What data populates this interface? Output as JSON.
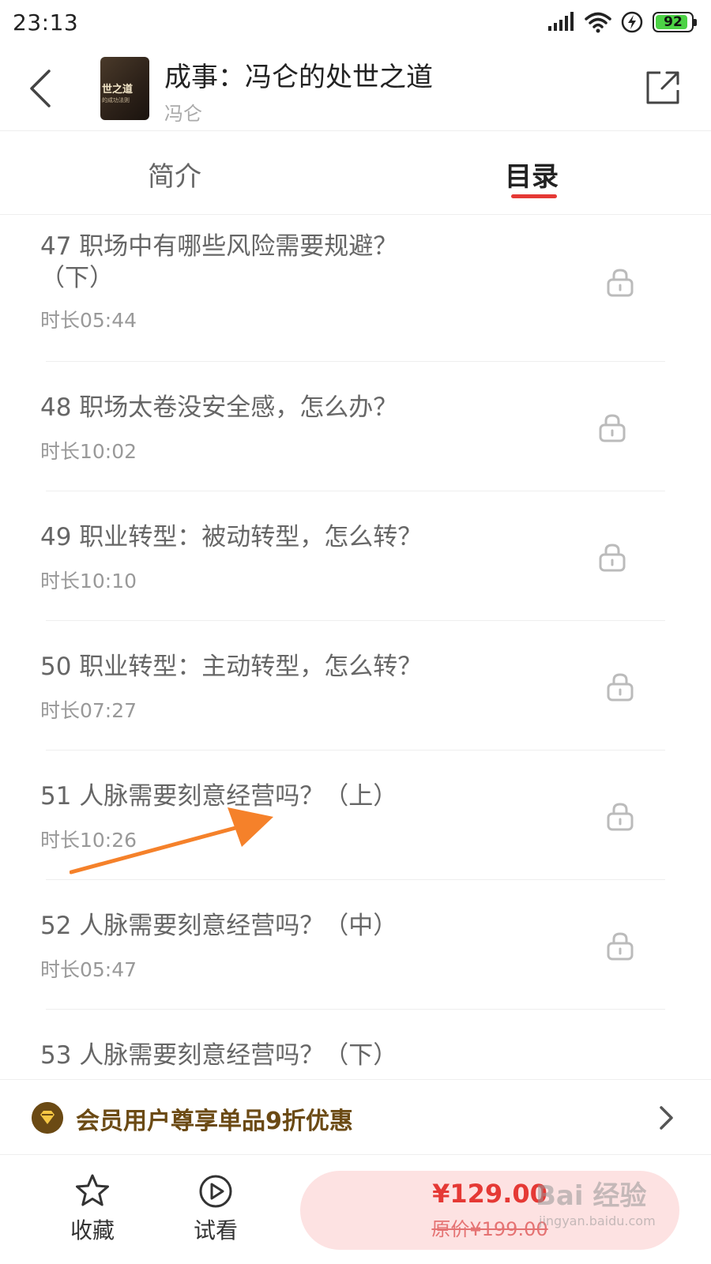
{
  "status_bar": {
    "time": "23:13",
    "battery_level": "92",
    "battery_fraction": 0.92,
    "icons": [
      "signal-icon",
      "wifi-icon",
      "charging-icon",
      "battery-icon"
    ]
  },
  "header": {
    "title": "成事：冯仑的处世之道",
    "author": "冯仑",
    "cover_text": "世之道",
    "cover_subtext": "的成功法则",
    "back_icon": "chevron-left-icon",
    "share_icon": "share-icon"
  },
  "tabs": [
    {
      "label": "简介",
      "active": false
    },
    {
      "label": "目录",
      "active": true
    }
  ],
  "accent_color": "#e53935",
  "chapters": [
    {
      "title": "47 职场中有哪些风险需要规避？（下）",
      "duration": "时长05:44",
      "locked": true
    },
    {
      "title": "48 职场太卷没安全感，怎么办？",
      "duration": "时长10:02",
      "locked": true
    },
    {
      "title": "49 职业转型：被动转型，怎么转？",
      "duration": "时长10:10",
      "locked": true
    },
    {
      "title": "50 职业转型：主动转型，怎么转？",
      "duration": "时长07:27",
      "locked": true
    },
    {
      "title": "51 人脉需要刻意经营吗？（上）",
      "duration": "时长10:26",
      "locked": true
    },
    {
      "title": "52 人脉需要刻意经营吗？（中）",
      "duration": "时长05:47",
      "locked": true
    },
    {
      "title": "53 人脉需要刻意经营吗？（下）",
      "duration": "",
      "locked": true
    }
  ],
  "promo": {
    "text": "会员用户尊享单品9折优惠",
    "color": "#6b4a14"
  },
  "bottom_bar": {
    "favorite_label": "收藏",
    "trial_label": "试看",
    "price": "¥129.00",
    "original_price": "原价¥199.00"
  },
  "watermark": {
    "text": "Bai 经验",
    "subtext": "jingyan.baidu.com"
  }
}
